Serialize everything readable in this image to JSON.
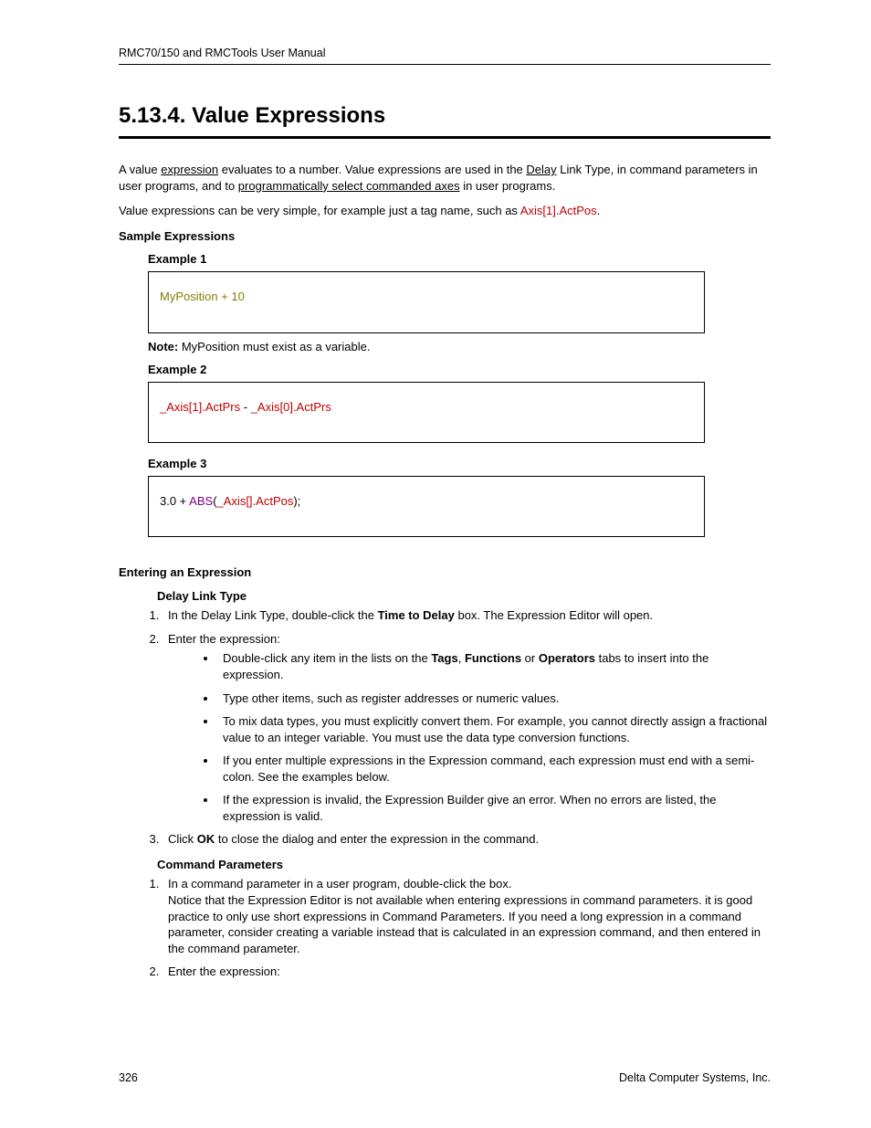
{
  "header": "RMC70/150 and RMCTools User Manual",
  "title": "5.13.4. Value Expressions",
  "intro1_a": "A value ",
  "intro1_b": "expression",
  "intro1_c": " evaluates to a number. Value expressions are used in the ",
  "intro1_d": "Delay",
  "intro1_e": " Link Type, in command parameters in user programs, and to ",
  "intro1_f": "programmatically select commanded axes",
  "intro1_g": " in user programs.",
  "intro2_a": "Value expressions can be very simple, for example just a tag name, such as ",
  "intro2_b": "Axis[1].ActPos",
  "intro2_c": ".",
  "sample_heading": "Sample Expressions",
  "ex1_label": "Example 1",
  "ex1_code": "MyPosition + 10",
  "ex1_note_label": "Note:",
  "ex1_note_text": " MyPosition must exist as a variable.",
  "ex2_label": "Example 2",
  "ex2_a": "_Axis[1].ActPrs",
  "ex2_b": " - ",
  "ex2_c": "_Axis[0].ActPrs",
  "ex3_label": "Example 3",
  "ex3_a": "3.0 + ",
  "ex3_b": "ABS",
  "ex3_c": "(",
  "ex3_d": "_Axis[].ActPos",
  "ex3_e": ");",
  "entering_heading": "Entering an Expression",
  "delay_heading": "Delay Link Type",
  "delay_li1_a": "In the Delay Link Type, double-click the ",
  "delay_li1_b": "Time to Delay",
  "delay_li1_c": " box. The Expression Editor will open.",
  "delay_li2": "Enter the expression:",
  "bullet1_a": "Double-click any item in the lists on the ",
  "bullet1_b": "Tags",
  "bullet1_c": ", ",
  "bullet1_d": "Functions",
  "bullet1_e": " or ",
  "bullet1_f": "Operators",
  "bullet1_g": " tabs to insert into the expression.",
  "bullet2": "Type other items, such as register addresses or numeric values.",
  "bullet3": "To mix data types, you must explicitly convert them. For example, you cannot directly assign a fractional value to an integer variable. You must use the data type conversion functions.",
  "bullet4": "If you enter multiple expressions in the Expression command, each expression must end with a semi-colon. See the examples below.",
  "bullet5": "If the expression is invalid, the Expression Builder give an error. When no errors are listed, the expression is valid.",
  "delay_li3_a": "Click ",
  "delay_li3_b": "OK",
  "delay_li3_c": " to close the dialog and enter the expression in the command.",
  "cmd_heading": "Command Parameters",
  "cmd_li1_a": "In a command parameter in a user program, double-click the box.",
  "cmd_li1_b": "Notice that the Expression Editor is not available when entering expressions in command parameters. it is good practice to only use short expressions in Command Parameters. If you need a long expression in a command parameter, consider creating a variable instead that is calculated in an expression command, and then entered in the command parameter.",
  "cmd_li2": "Enter the expression:",
  "page_number": "326",
  "footer_right": "Delta Computer Systems, Inc."
}
